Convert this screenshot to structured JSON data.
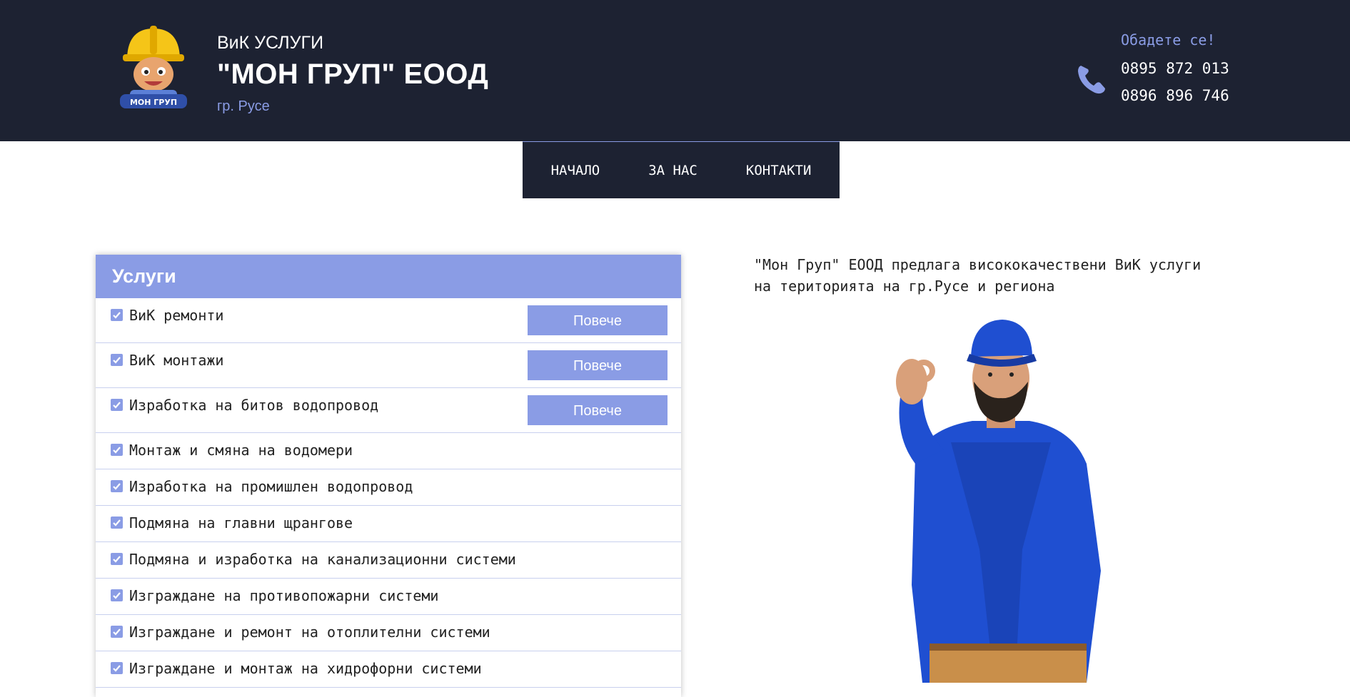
{
  "header": {
    "brand_sub": "ВиК УСЛУГИ",
    "brand_title": "\"МОН ГРУП\" ЕООД",
    "brand_city": "гр. Русе",
    "logo_text": "МОН ГРУП",
    "call_label": "Обадете се!",
    "phones": [
      "0895 872 013",
      "0896 896 746"
    ]
  },
  "nav": {
    "items": [
      {
        "label": "НАЧАЛО"
      },
      {
        "label": "ЗА НАС"
      },
      {
        "label": "КОНТАКТИ"
      }
    ]
  },
  "services": {
    "title": "Услуги",
    "more_label": "Повече",
    "items": [
      {
        "label": "ВиК ремонти",
        "has_more": true
      },
      {
        "label": "ВиК монтажи",
        "has_more": true
      },
      {
        "label": "Изработка на битов водопровод",
        "has_more": true
      },
      {
        "label": "Монтаж и смяна на водомери",
        "has_more": false
      },
      {
        "label": "Изработка на промишлен водопровод",
        "has_more": false
      },
      {
        "label": "Подмяна на главни щрангове",
        "has_more": false
      },
      {
        "label": "Подмяна и изработка на канализационни системи",
        "has_more": false
      },
      {
        "label": "Изграждане на противопожарни системи",
        "has_more": false
      },
      {
        "label": "Изграждане и ремонт на отоплителни системи",
        "has_more": false
      },
      {
        "label": "Изграждане и монтаж на хидрофорни системи",
        "has_more": false
      }
    ]
  },
  "intro": {
    "text": "\"Мон Груп\" ЕООД предлага висококачествени ВиК услуги на територията на гр.Русе и региона"
  },
  "colors": {
    "header_bg": "#1d2232",
    "accent": "#8a9ce5",
    "text": "#222222"
  },
  "icons": {
    "phone": "phone-icon",
    "check": "checkbox-checked-icon"
  }
}
